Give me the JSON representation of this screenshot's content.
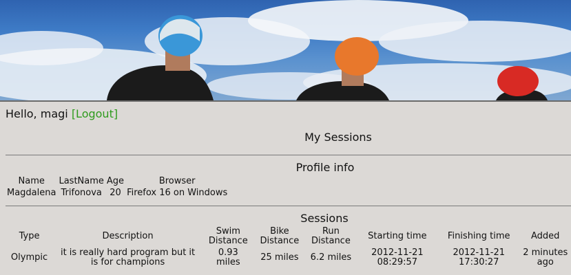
{
  "header": {
    "greeting": "Hello, magi",
    "logout_label": "[Logout]"
  },
  "main": {
    "title": "My Sessions",
    "profile": {
      "title": "Profile info",
      "columns": [
        "Name",
        "LastName",
        "Age",
        "Browser"
      ],
      "row": [
        "Magdalena",
        "Trifonova",
        "20",
        "Firefox 16 on Windows"
      ]
    },
    "sessions": {
      "title": "Sessions",
      "columns": [
        "Type",
        "Description",
        "Swim Distance",
        "Bike Distance",
        "Run Distance",
        "Starting time",
        "Finishing time",
        "Added"
      ],
      "rows": [
        [
          "Olympic",
          "it is really hard program but it is for champions",
          "0.93 miles",
          "25 miles",
          "6.2 miles",
          "2012-11-21 08:29:57",
          "2012-11-21 17:30:27",
          "2 minutes ago"
        ]
      ]
    }
  },
  "colors": {
    "logout_link": "#2e9b1d",
    "background": "#dcd9d6"
  }
}
